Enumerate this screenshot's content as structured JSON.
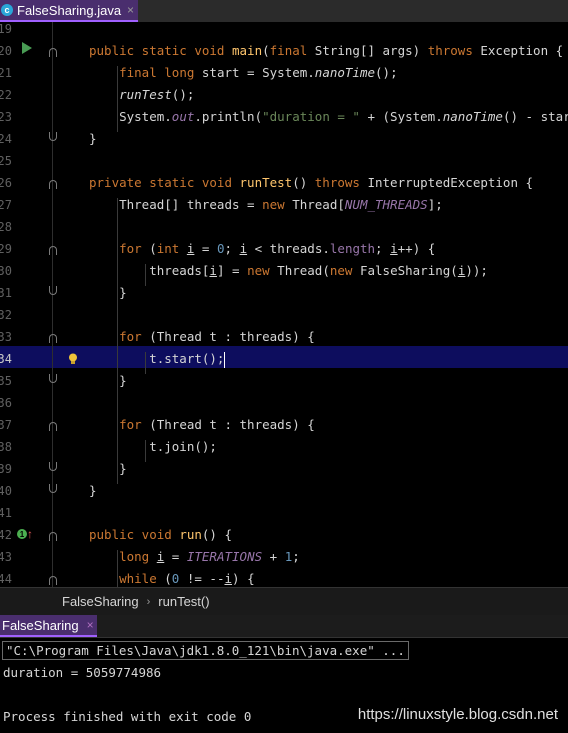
{
  "editor_tab": {
    "file_name": "FalseSharing.java",
    "icon_letter": "c",
    "close_glyph": "×"
  },
  "editor": {
    "line_numbers": [
      "19",
      "20",
      "21",
      "22",
      "23",
      "24",
      "25",
      "26",
      "27",
      "28",
      "29",
      "30",
      "31",
      "32",
      "33",
      "34",
      "35",
      "36",
      "37",
      "38",
      "39",
      "40",
      "41",
      "42",
      "43",
      "44"
    ],
    "current_line": "34"
  },
  "gutter": {
    "override_badge": "1",
    "override_arrow": "↑"
  },
  "breadcrumbs": {
    "class_name": "FalseSharing",
    "separator": "›",
    "method_name": "runTest()"
  },
  "run_panel": {
    "tab_label": "FalseSharing",
    "close_glyph": "×"
  },
  "console": {
    "command": "\"C:\\Program Files\\Java\\jdk1.8.0_121\\bin\\java.exe\" ...",
    "output_line": "duration = 5059774986",
    "exit_line": "Process finished with exit code 0"
  },
  "watermark": "https://linuxstyle.blog.csdn.net",
  "colors": {
    "keyword": "#cc7832",
    "method": "#ffc66d",
    "static_field": "#9876aa",
    "string": "#6a8759",
    "number": "#6897bb",
    "current_line_bg": "#0d0d5e",
    "tab_active": "#4a2e6e"
  }
}
